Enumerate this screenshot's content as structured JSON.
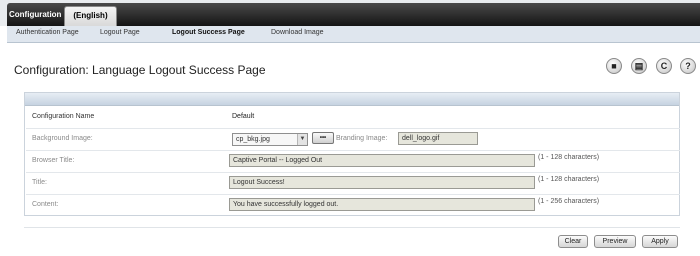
{
  "tabs": [
    {
      "label": "Configuration",
      "active": false
    },
    {
      "label": "(English)",
      "active": true
    }
  ],
  "subnav": [
    {
      "label": "Authentication Page"
    },
    {
      "label": "Logout Page"
    },
    {
      "label": "Logout Success Page"
    },
    {
      "label": "Download Image"
    }
  ],
  "page_title": "Configuration: Language Logout Success Page",
  "toolbar_icons": [
    "save-icon",
    "print-icon",
    "refresh-icon",
    "help-icon"
  ],
  "form": {
    "config_name": {
      "label": "Configuration Name",
      "value": "Default"
    },
    "background_image": {
      "label": "Background Image:",
      "selected": "cp_bkg.jpg",
      "browse_label": "•••"
    },
    "branding_image": {
      "label": "Branding Image:",
      "value": "dell_logo.gif"
    },
    "browser_title": {
      "label": "Browser Title:",
      "value": "Captive Portal -- Logged Out",
      "hint": "(1 - 128 characters)"
    },
    "title": {
      "label": "Title:",
      "value": "Logout Success!",
      "hint": "(1 - 128 characters)"
    },
    "content": {
      "label": "Content:",
      "value": "You have successfully logged out.",
      "hint": "(1 - 256 characters)"
    }
  },
  "buttons": {
    "clear": "Clear",
    "preview": "Preview",
    "apply": "Apply"
  },
  "colors": {
    "topbar": "#1e1e1e",
    "subnav": "#dfe6ee",
    "panel_header": "#c6d3e1",
    "field_bg": "#e6e6dc"
  }
}
